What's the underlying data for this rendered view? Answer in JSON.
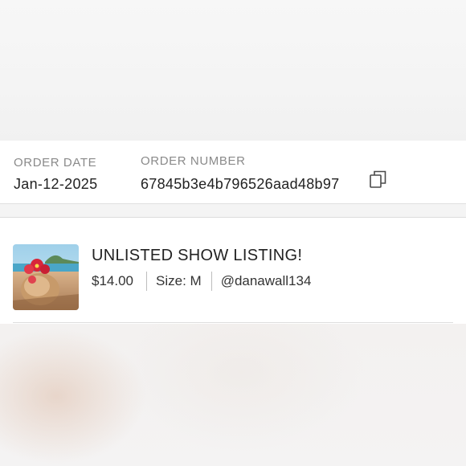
{
  "order": {
    "date_label": "ORDER DATE",
    "date_value": "Jan-12-2025",
    "number_label": "ORDER NUMBER",
    "number_value": "67845b3e4b796526aad48b97"
  },
  "icons": {
    "copy": "copy-icon"
  },
  "item": {
    "title": "UNLISTED SHOW LISTING!",
    "price": "$14.00",
    "size": "Size: M",
    "seller": "@danawall134"
  },
  "colors": {
    "panel_bg": "#ffffff",
    "page_bg": "#f6f5f5",
    "label_gray": "#8a8a8a",
    "divider": "#bdbdbd"
  }
}
